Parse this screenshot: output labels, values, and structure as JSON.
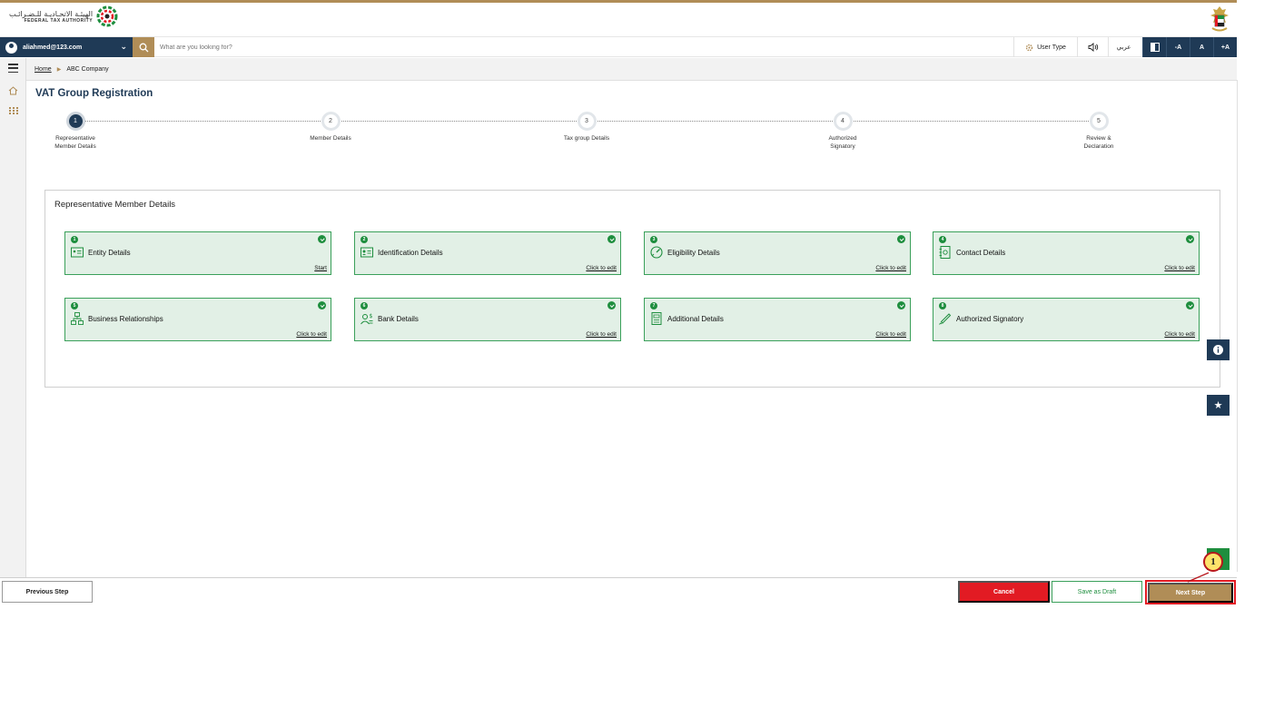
{
  "header": {
    "logo_ar": "الهيئـة الاتحـاديـة للـضـرائـب",
    "logo_en": "FEDERAL TAX AUTHORITY"
  },
  "navbar": {
    "user_email": "aliahmed@123.com",
    "search_placeholder": "What are you looking for?",
    "user_type_label": "User Type",
    "language_label": "عربي",
    "font_decrease": "-A",
    "font_default": "A",
    "font_increase": "+A"
  },
  "breadcrumb": {
    "home": "Home",
    "current": "ABC Company"
  },
  "page": {
    "title": "VAT Group Registration"
  },
  "stepper": {
    "active_step": 1,
    "steps": [
      {
        "number": "1",
        "label_line1": "Representative",
        "label_line2": "Member Details"
      },
      {
        "number": "2",
        "label_line1": "Member Details",
        "label_line2": ""
      },
      {
        "number": "3",
        "label_line1": "Tax group Details",
        "label_line2": ""
      },
      {
        "number": "4",
        "label_line1": "Authorized",
        "label_line2": "Signatory"
      },
      {
        "number": "5",
        "label_line1": "Review &",
        "label_line2": "Declaration"
      }
    ]
  },
  "section": {
    "title": "Representative Member Details",
    "tiles": [
      {
        "number": "1",
        "name": "Entity Details",
        "link": "Start",
        "icon": "id-card-icon"
      },
      {
        "number": "2",
        "name": "Identification Details",
        "link": "Click to edit",
        "icon": "identification-icon"
      },
      {
        "number": "3",
        "name": "Eligibility Details",
        "link": "Click to edit",
        "icon": "gauge-icon"
      },
      {
        "number": "4",
        "name": "Contact Details",
        "link": "Click to edit",
        "icon": "contact-book-icon"
      },
      {
        "number": "5",
        "name": "Business Relationships",
        "link": "Click to edit",
        "icon": "org-chart-icon"
      },
      {
        "number": "6",
        "name": "Bank Details",
        "link": "Click to edit",
        "icon": "bank-user-icon"
      },
      {
        "number": "7",
        "name": "Additional Details",
        "link": "Click to edit",
        "icon": "document-icon"
      },
      {
        "number": "8",
        "name": "Authorized Signatory",
        "link": "Click to edit",
        "icon": "pen-icon"
      }
    ]
  },
  "footer": {
    "previous_label": "Previous Step",
    "cancel_label": "Cancel",
    "draft_label": "Save as Draft",
    "next_label": "Next Step"
  },
  "annotation": {
    "callout_number": "1"
  },
  "colors": {
    "primary": "#1f3a56",
    "gold": "#b08d57",
    "success": "#1e8e3e",
    "tile_bg": "#e2f0e6",
    "danger": "#e21b23"
  }
}
